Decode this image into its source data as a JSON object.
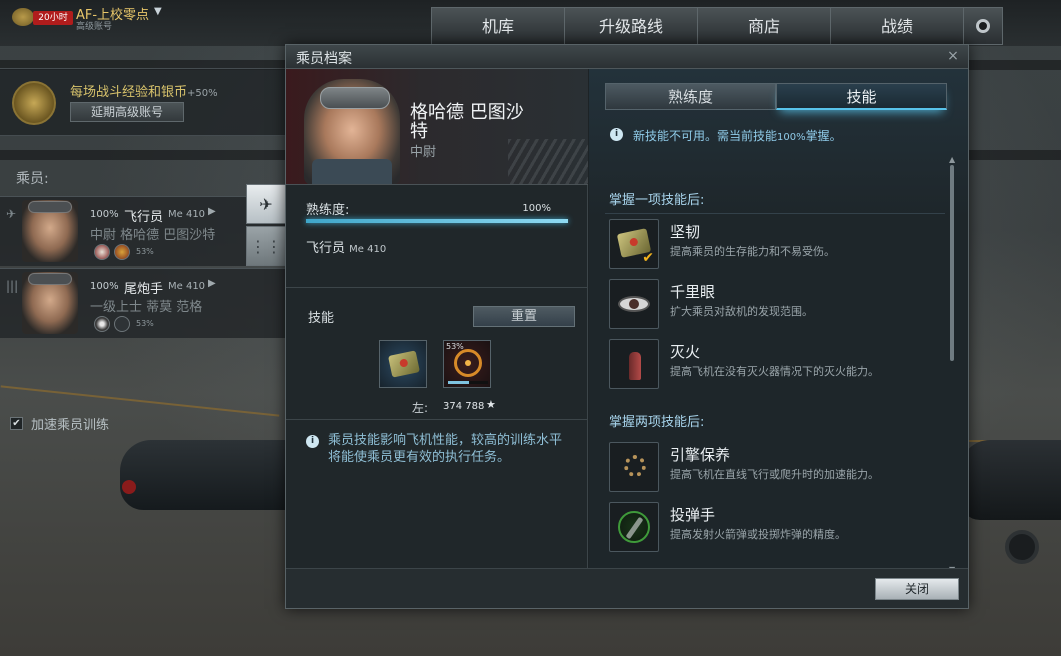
{
  "topbar": {
    "premium_timer": "20小时",
    "player_name": "AF-上校零点",
    "account_type": "高级账号",
    "nav_tabs": [
      "机库",
      "升级路线",
      "商店",
      "战绩"
    ]
  },
  "premium": {
    "bonus_text": "每场战斗经验和银币",
    "bonus_value": "+50%",
    "extend_label": "延期高级账号"
  },
  "crew": {
    "label": "乘员:",
    "members": [
      {
        "percent": "100%",
        "role": "飞行员",
        "plane": "Me 410",
        "name": "中尉 格哈德 巴图沙特",
        "skill_percent": "53%"
      },
      {
        "percent": "100%",
        "role": "尾炮手",
        "plane": "Me 410",
        "name": "一级上士 蒂莫 范格",
        "skill_percent": "53%"
      }
    ],
    "accelerate_label": "加速乘员训练",
    "accelerate_checked": "✔"
  },
  "dialog": {
    "title": "乘员档案",
    "close_x": "×",
    "crew_name": "格哈德 巴图沙特",
    "crew_rank": "中尉",
    "proficiency_label": "熟练度:",
    "proficiency_value": "100%",
    "proficiency_fraction": 1.0,
    "role": "飞行员",
    "role_plane": "Me 410",
    "skills_label": "技能",
    "reset_label": "重置",
    "slot_percent": "53%",
    "slot_progress_fraction": 0.53,
    "remaining_label": "左:",
    "remaining_value": "374 788",
    "left_note": "乘员技能影响飞机性能，较高的训练水平将能使乘员更有效的执行任务。",
    "tabs": [
      "熟练度",
      "技能"
    ],
    "notice_a": "新技能不可用。需当前技能",
    "notice_pct": "100%",
    "notice_b": "掌握。",
    "group1_title": "掌握一项技能后:",
    "group2_title": "掌握两项技能后:",
    "skills": [
      {
        "name": "坚韧",
        "desc": "提高乘员的生存能力和不易受伤。"
      },
      {
        "name": "千里眼",
        "desc": "扩大乘员对敌机的发现范围。"
      },
      {
        "name": "灭火",
        "desc": "提高飞机在没有灭火器情况下的灭火能力。"
      },
      {
        "name": "引擎保养",
        "desc": "提高飞机在直线飞行或爬升时的加速能力。"
      },
      {
        "name": "投弹手",
        "desc": "提高发射火箭弹或投掷炸弹的精度。"
      }
    ],
    "scroll_up": "▲",
    "scroll_down": "▼",
    "close_label": "关闭"
  }
}
